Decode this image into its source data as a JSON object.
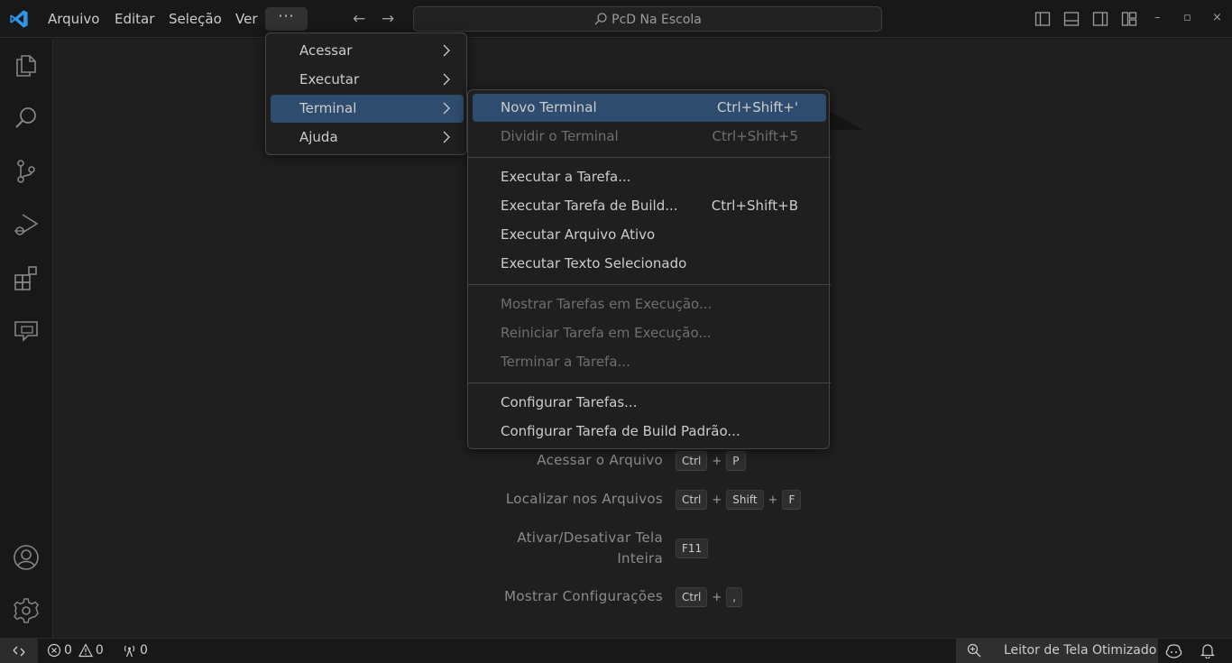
{
  "titlebar": {
    "menus": [
      "Arquivo",
      "Editar",
      "Seleção",
      "Ver"
    ],
    "more_label": "···",
    "search_text": "PcD Na Escola",
    "window_controls": [
      "–",
      "▫",
      "×"
    ]
  },
  "menu_level1": [
    {
      "label": "Acessar"
    },
    {
      "label": "Executar"
    },
    {
      "label": "Terminal"
    },
    {
      "label": "Ajuda"
    }
  ],
  "terminal_menu": {
    "group1": [
      {
        "label": "Novo Terminal",
        "key": "Ctrl+Shift+'"
      },
      {
        "label": "Dividir o Terminal",
        "key": "Ctrl+Shift+5"
      }
    ],
    "group2": [
      {
        "label": "Executar a Tarefa...",
        "key": ""
      },
      {
        "label": "Executar Tarefa de Build...",
        "key": "Ctrl+Shift+B"
      },
      {
        "label": "Executar Arquivo Ativo",
        "key": ""
      },
      {
        "label": "Executar Texto Selecionado",
        "key": ""
      }
    ],
    "group3": [
      {
        "label": "Mostrar Tarefas em Execução...",
        "key": ""
      },
      {
        "label": "Reiniciar Tarefa em Execução...",
        "key": ""
      },
      {
        "label": "Terminar a Tarefa...",
        "key": ""
      }
    ],
    "group4": [
      {
        "label": "Configurar Tarefas...",
        "key": ""
      },
      {
        "label": "Configurar Tarefa de Build Padrão...",
        "key": ""
      }
    ]
  },
  "shortcuts": [
    {
      "label": "Acessar o Arquivo",
      "keys": [
        "Ctrl",
        "P"
      ]
    },
    {
      "label": "Localizar nos Arquivos",
      "keys": [
        "Ctrl",
        "Shift",
        "F"
      ]
    },
    {
      "label_line1": "Ativar/Desativar Tela",
      "label_line2": "Inteira",
      "keys": [
        "F11"
      ]
    },
    {
      "label": "Mostrar Configurações",
      "keys": [
        "Ctrl",
        ","
      ]
    }
  ],
  "statusbar": {
    "errors": "0",
    "warnings": "0",
    "ports": "0",
    "screen_reader": "Leitor de Tela Otimizado"
  },
  "colors": {
    "accent": "#2e4c6e",
    "background": "#1f1f1f",
    "logo": "#0078d4"
  },
  "icons": [
    "vscode-logo",
    "explorer-icon",
    "search-icon",
    "source-control-icon",
    "run-debug-icon",
    "extensions-icon",
    "chat-icon",
    "account-icon",
    "settings-gear-icon",
    "remote-icon",
    "error-icon",
    "warning-icon",
    "ports-icon",
    "zoom-icon",
    "copilot-icon",
    "bell-icon"
  ]
}
